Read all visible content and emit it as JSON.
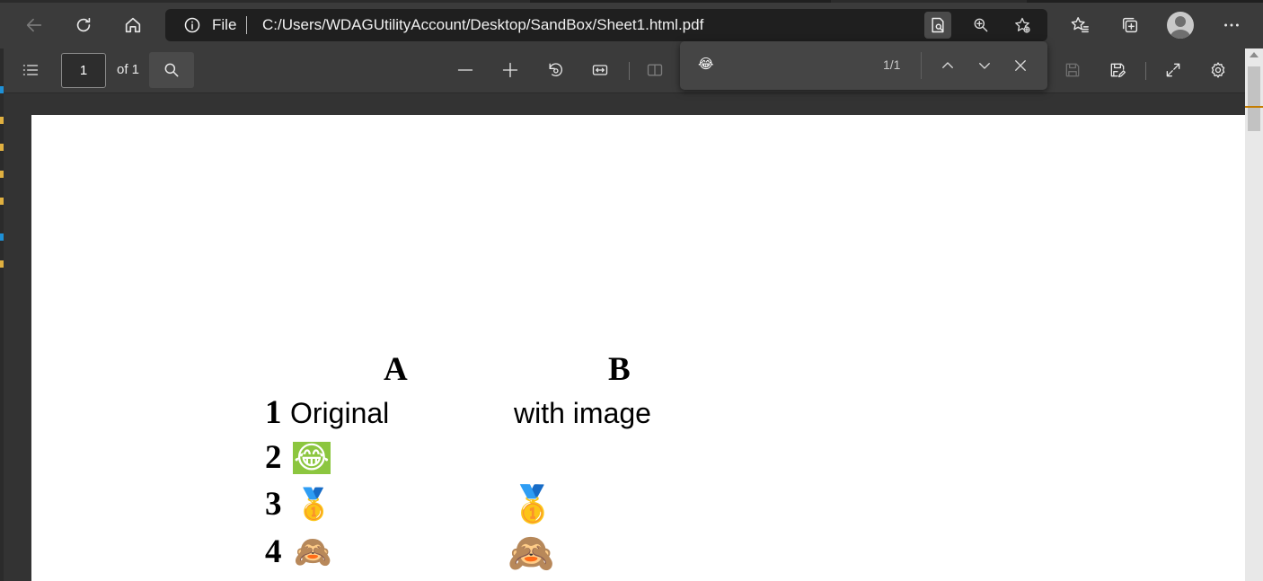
{
  "browser": {
    "address_scheme": "File",
    "address_url": "C:/Users/WDAGUtilityAccount/Desktop/SandBox/Sheet1.html.pdf",
    "icons": [
      "back-icon",
      "refresh-icon",
      "home-icon",
      "info-icon",
      "read-aloud-icon",
      "zoom-icon",
      "add-favorite-icon",
      "favorites-icon",
      "collections-icon",
      "profile-avatar",
      "more-icon"
    ]
  },
  "pdf_toolbar": {
    "page_number": "1",
    "page_total": "of 1",
    "icons": [
      "contents-icon",
      "search-icon",
      "zoom-out-icon",
      "zoom-in-icon",
      "rotate-icon",
      "fit-width-icon",
      "page-view-icon",
      "save-icon",
      "save-as-icon",
      "fullscreen-icon",
      "settings-icon"
    ]
  },
  "find_bar": {
    "query": "😂",
    "match_count": "1/1",
    "icons": [
      "previous-icon",
      "next-icon",
      "close-icon"
    ]
  },
  "document": {
    "column_headers": [
      "A",
      "B"
    ],
    "rows": [
      {
        "num": "1",
        "a": "Original",
        "b": "with image"
      },
      {
        "num": "2",
        "a": "😂",
        "b": "😂"
      },
      {
        "num": "3",
        "a": "🥇",
        "b": "🥇"
      },
      {
        "num": "4",
        "a": "🙈",
        "b": "🙈"
      }
    ]
  },
  "colors": {
    "chrome": "#3b3b3b",
    "address_bar": "#1f1f1f",
    "page": "#ffffff",
    "find_highlight": "#8cc63f",
    "scroll_mark": "#c47c00"
  }
}
